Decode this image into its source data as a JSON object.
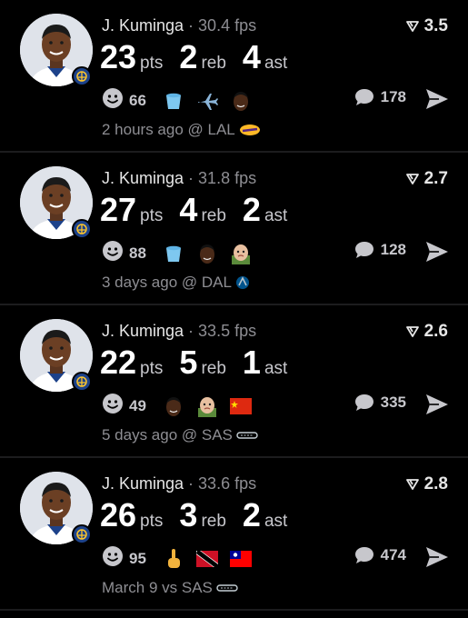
{
  "feed": {
    "cards": [
      {
        "player_name": "J. Kuminga",
        "separator": "·",
        "fps": "30.4 fps",
        "rating": "3.5",
        "points": "23",
        "points_unit": "pts",
        "rebounds": "2",
        "rebounds_unit": "reb",
        "assists": "4",
        "assists_unit": "ast",
        "reaction_count": "66",
        "reaction_emojis": [
          "bucket",
          "airplane",
          "player-face"
        ],
        "comment_count": "178",
        "time_location": "2 hours ago @ LAL",
        "opponent_logo": "lakers-logo"
      },
      {
        "player_name": "J. Kuminga",
        "separator": "·",
        "fps": "31.8 fps",
        "rating": "2.7",
        "points": "27",
        "points_unit": "pts",
        "rebounds": "4",
        "rebounds_unit": "reb",
        "assists": "2",
        "assists_unit": "ast",
        "reaction_count": "88",
        "reaction_emojis": [
          "bucket",
          "player-face",
          "baby-face"
        ],
        "comment_count": "128",
        "time_location": "3 days ago @ DAL",
        "opponent_logo": "mavericks-logo"
      },
      {
        "player_name": "J. Kuminga",
        "separator": "·",
        "fps": "33.5 fps",
        "rating": "2.6",
        "points": "22",
        "points_unit": "pts",
        "rebounds": "5",
        "rebounds_unit": "reb",
        "assists": "1",
        "assists_unit": "ast",
        "reaction_count": "49",
        "reaction_emojis": [
          "player-face",
          "baby-face",
          "china-flag"
        ],
        "comment_count": "335",
        "time_location": "5 days ago @ SAS",
        "opponent_logo": "spurs-logo"
      },
      {
        "player_name": "J. Kuminga",
        "separator": "·",
        "fps": "33.6 fps",
        "rating": "2.8",
        "points": "26",
        "points_unit": "pts",
        "rebounds": "3",
        "rebounds_unit": "reb",
        "assists": "2",
        "assists_unit": "ast",
        "reaction_count": "95",
        "reaction_emojis": [
          "middle-finger",
          "trinidad-flag",
          "taiwan-flag"
        ],
        "comment_count": "474",
        "time_location": "March 9 vs SAS",
        "opponent_logo": "spurs-logo"
      }
    ]
  },
  "colors": {
    "background": "#000000",
    "divider": "#1c1c1e",
    "primary_text": "#ffffff",
    "secondary_text": "#8e8e93",
    "team_blue": "#1d428a",
    "team_gold": "#ffc72c"
  }
}
